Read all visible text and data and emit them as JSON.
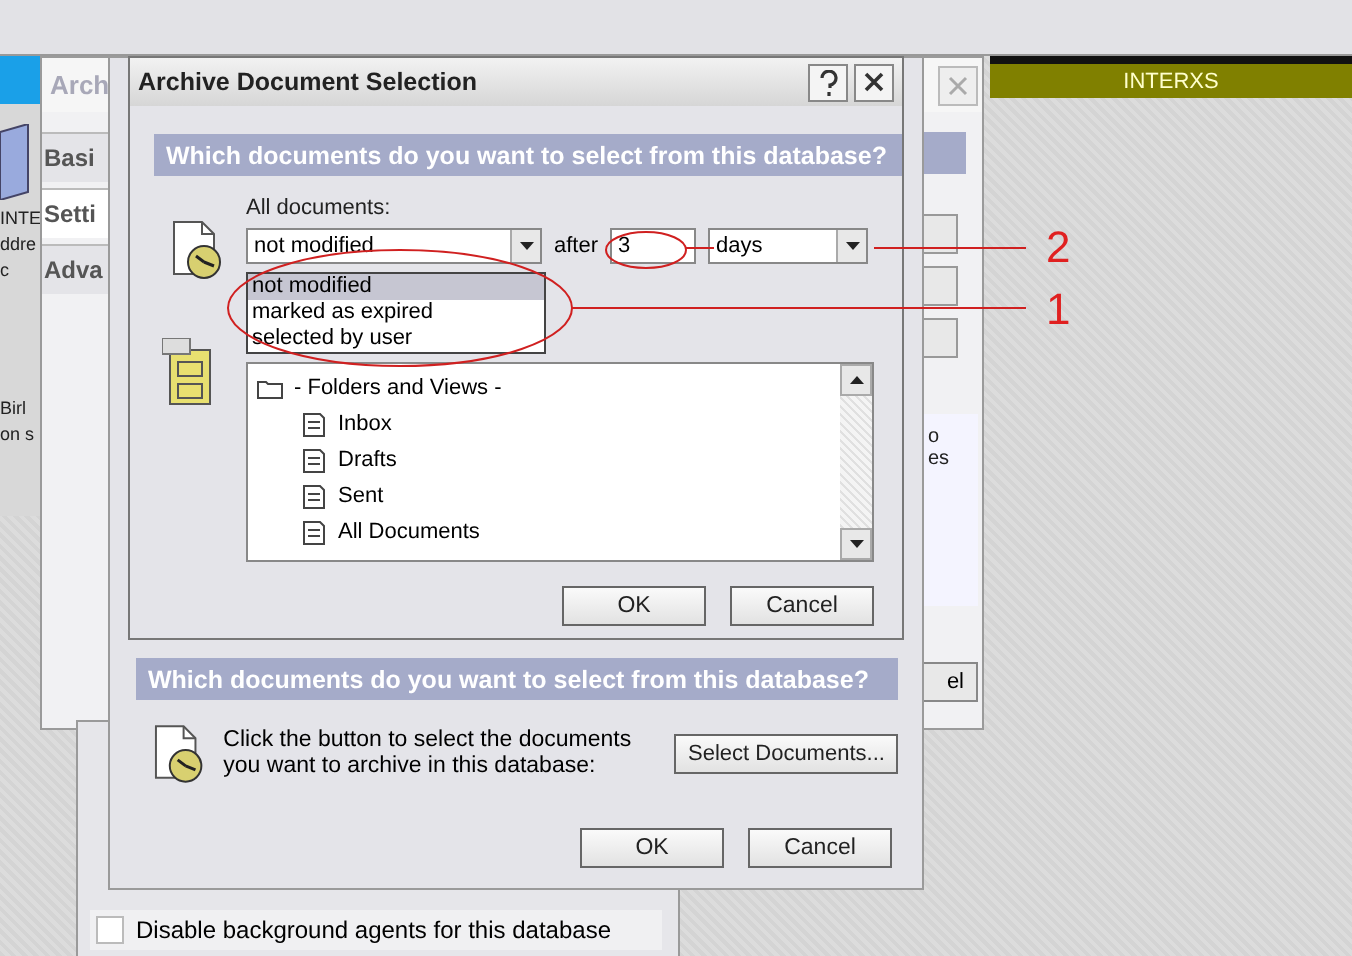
{
  "background_window": {
    "texts": [
      "INTE",
      "ddre",
      "c",
      "Birl",
      "on s"
    ]
  },
  "settings_window": {
    "title": "Arch",
    "tabs": [
      {
        "label": "Basi",
        "selected": false
      },
      {
        "label": "Setti",
        "selected": true
      },
      {
        "label": "Adva",
        "selected": false
      }
    ],
    "side_texts": [
      "o",
      "es"
    ],
    "button_fragment": "el"
  },
  "interxs_window": {
    "title": "INTERXS"
  },
  "options_panel": {
    "checkboxes": [
      {
        "label": "Disable background agents for this database",
        "checked": false
      }
    ]
  },
  "archive_dialog": {
    "heading": "Which documents do you want to select from this database?",
    "prompt": "Click the button to select the documents you want to archive in this database:",
    "select_button": "Select Documents...",
    "buttons": [
      "OK",
      "Cancel"
    ]
  },
  "selection_dialog": {
    "title": "Archive Document Selection",
    "heading": "Which documents do you want to select from this database?",
    "label": "All documents:",
    "criterion": "not modified",
    "after_label": "after",
    "amount": "3",
    "unit": "days",
    "dropdown_options": [
      {
        "label": "not modified",
        "selected": true
      },
      {
        "label": "marked as expired",
        "selected": false
      },
      {
        "label": "selected by user",
        "selected": false
      }
    ],
    "tree": {
      "label": "- Folders and Views -",
      "children": [
        {
          "label": "Inbox"
        },
        {
          "label": "Drafts"
        },
        {
          "label": "Sent"
        },
        {
          "label": "All Documents"
        }
      ]
    },
    "buttons": [
      "OK",
      "Cancel"
    ]
  },
  "annotations": [
    {
      "label": "2"
    },
    {
      "label": "1"
    }
  ]
}
